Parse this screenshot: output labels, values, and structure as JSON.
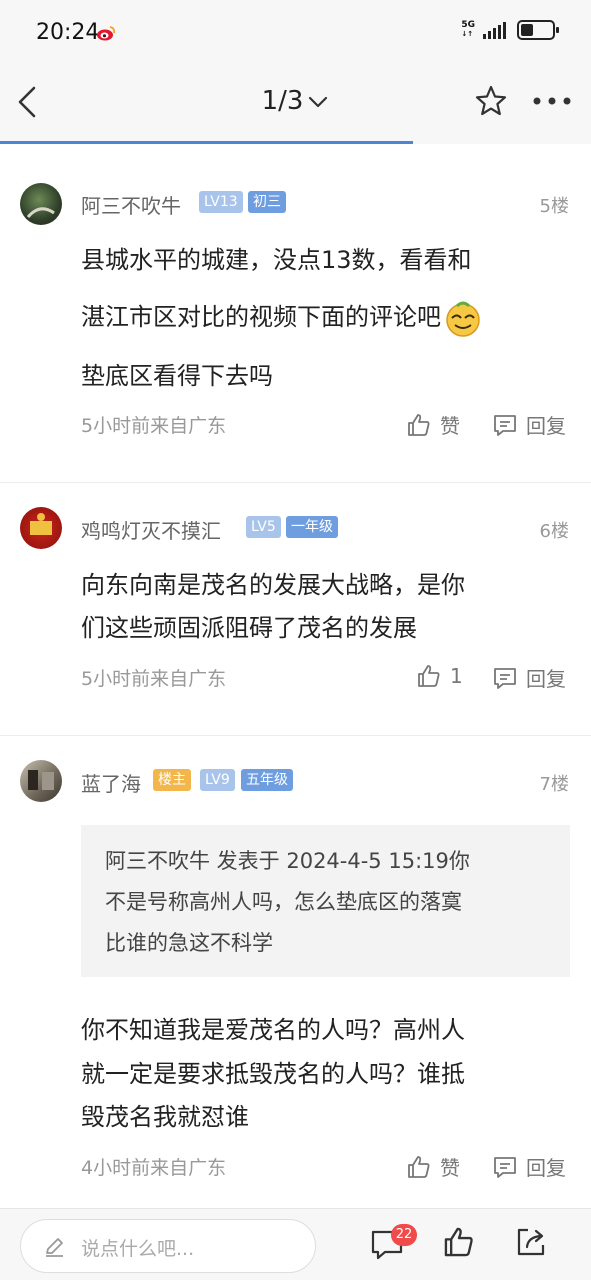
{
  "status_bar": {
    "time": "20:24",
    "network": "5G"
  },
  "nav": {
    "page_indicator": "1/3"
  },
  "comments": [
    {
      "username": "阿三不吹牛",
      "badges": [
        "LV13",
        "初三"
      ],
      "floor": "5楼",
      "lines": [
        "县城水平的城建，没点13数，看看和",
        "湛江市区对比的视频下面的评论吧",
        "垫底区看得下去吗"
      ],
      "time_location": "5小时前来自广东",
      "like_label": "赞",
      "reply_label": "回复"
    },
    {
      "username": "鸡鸣灯灭不摸汇",
      "badges": [
        "LV5",
        "一年级"
      ],
      "floor": "6楼",
      "lines": [
        "向东向南是茂名的发展大战略，是你",
        "们这些顽固派阻碍了茂名的发展"
      ],
      "time_location": "5小时前来自广东",
      "like_label": "1",
      "reply_label": "回复"
    },
    {
      "username": "蓝了海",
      "badges": [
        "楼主",
        "LV9",
        "五年级"
      ],
      "floor": "7楼",
      "quote_lines": [
        "阿三不吹牛 发表于 2024-4-5 15:19你",
        "不是号称高州人吗，怎么垫底区的落寞",
        "比谁的急这不科学"
      ],
      "lines": [
        "你不知道我是爱茂名的人吗？高州人",
        "就一定是要求抵毁茂名的人吗？谁抵",
        "毁茂名我就怼谁"
      ],
      "time_location": "4小时前来自广东",
      "like_label": "赞",
      "reply_label": "回复"
    }
  ],
  "bottom_bar": {
    "input_placeholder": "说点什么吧...",
    "comment_count": "22"
  },
  "colors": {
    "badge_blue_light": "#a9c4ea",
    "badge_blue": "#6f9ee0",
    "badge_orange": "#f2b64a",
    "accent_line": "#4e84d6",
    "red_badge": "#f04a4a"
  },
  "icons": [
    "weibo-icon",
    "signal-icon",
    "battery-icon",
    "back-icon",
    "chevron-down-icon",
    "star-icon",
    "more-icon",
    "emoji-icon",
    "thumb-up-icon",
    "reply-icon",
    "pen-icon",
    "comment-icon",
    "share-icon"
  ]
}
